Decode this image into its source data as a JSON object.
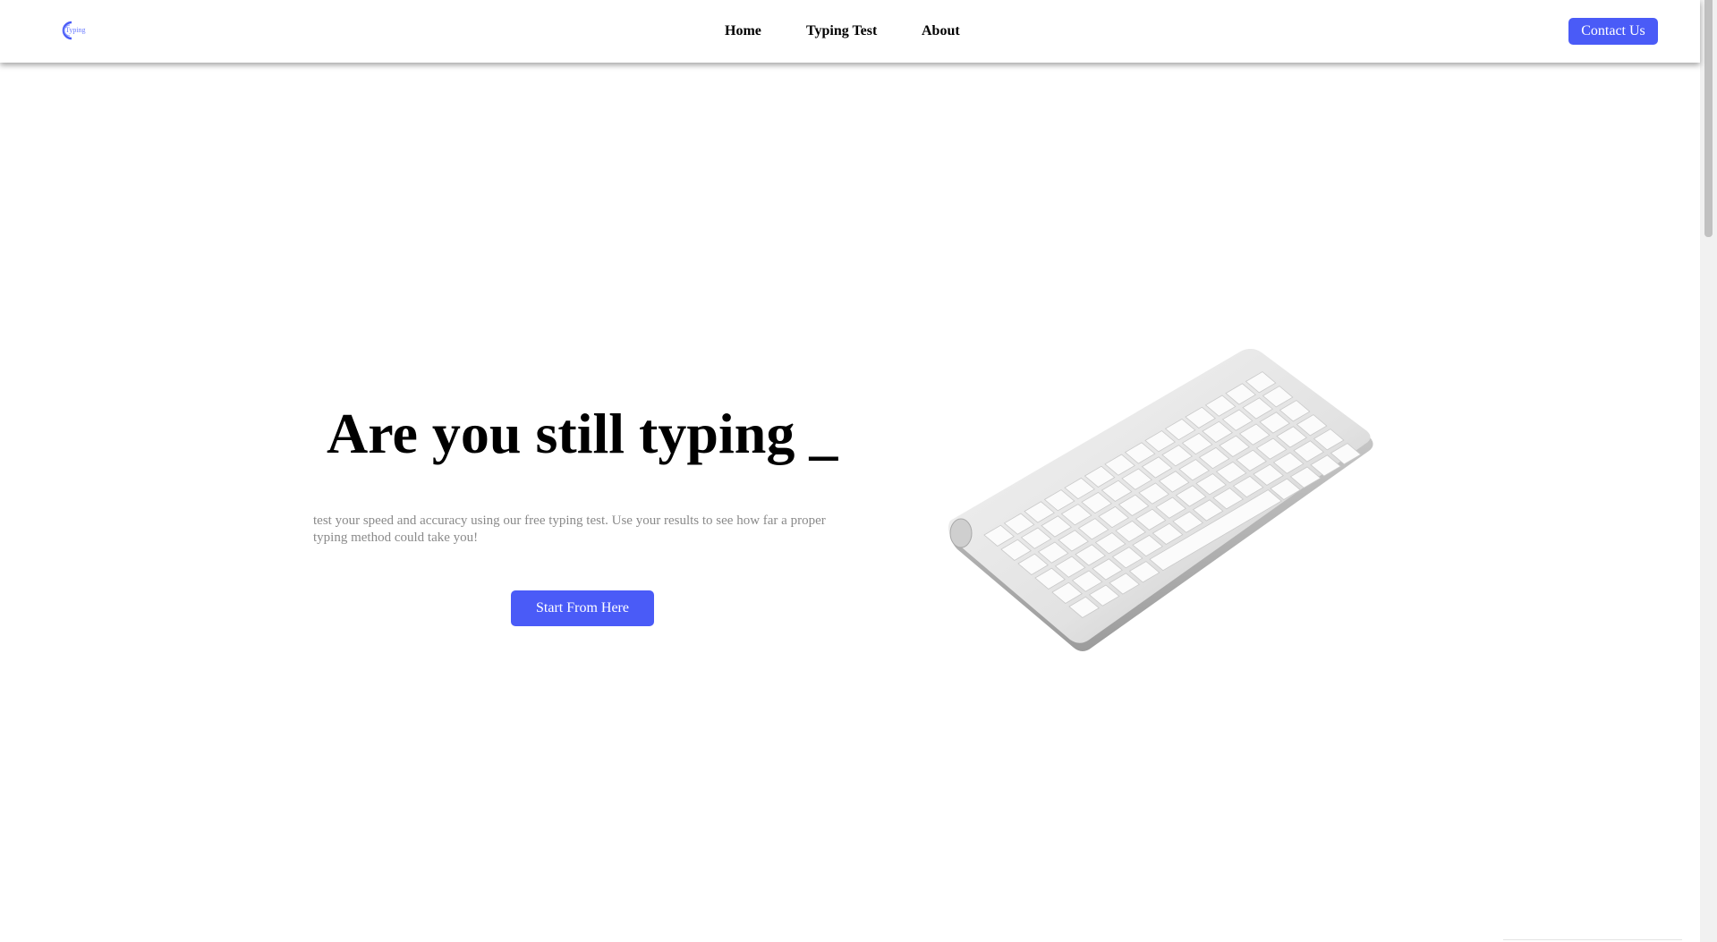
{
  "brand": {
    "logo_text": "Typing",
    "logo_color": "#6b7cff"
  },
  "nav": {
    "items": [
      {
        "label": "Home"
      },
      {
        "label": "Typing Test"
      },
      {
        "label": "About"
      }
    ],
    "contact_label": "Contact Us"
  },
  "hero": {
    "title": "Are you still typing _",
    "description": "test your speed and accuracy using our free typing test. Use your results to see how far a proper typing method could take you!",
    "cta_label": "Start From Here",
    "image": "keyboard-illustration"
  },
  "colors": {
    "accent": "#4a5bf7",
    "text": "#000000",
    "muted": "#8a8a8a"
  }
}
